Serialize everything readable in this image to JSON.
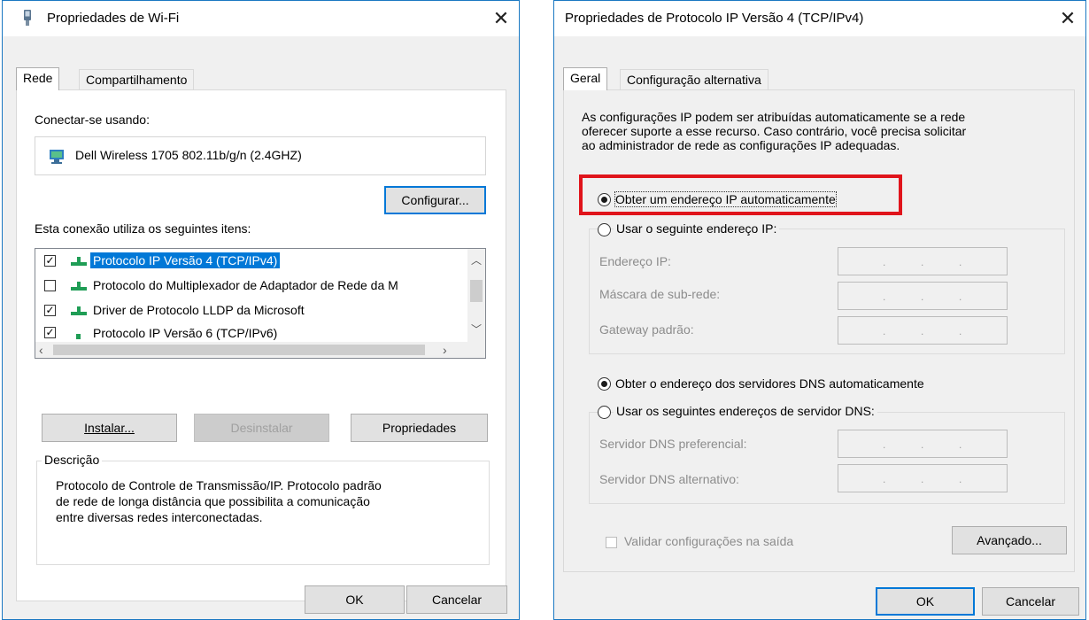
{
  "wifi_dialog": {
    "title": "Propriedades de Wi-Fi",
    "tabs": [
      {
        "label": "Rede",
        "active": true
      },
      {
        "label": "Compartilhamento",
        "active": false
      }
    ],
    "connect_using_label": "Conectar-se usando:",
    "adapter_name": "Dell Wireless 1705 802.11b/g/n (2.4GHZ)",
    "configure_button": "Configurar...",
    "items_label": "Esta conexão utiliza os seguintes itens:",
    "items": [
      {
        "label": "Protocolo IP Versão 4 (TCP/IPv4)",
        "checked": true,
        "selected": true
      },
      {
        "label": "Protocolo do Multiplexador de Adaptador de Rede da M",
        "checked": false,
        "selected": false
      },
      {
        "label": "Driver de Protocolo LLDP da Microsoft",
        "checked": true,
        "selected": false
      },
      {
        "label": "Protocolo IP Versão 6 (TCP/IPv6)",
        "checked": true,
        "selected": false
      }
    ],
    "buttons": {
      "install": "Instalar...",
      "uninstall": "Desinstalar",
      "properties": "Propriedades"
    },
    "description_title": "Descrição",
    "description_text": [
      "Protocolo de Controle de Transmissão/IP. Protocolo padrão",
      "de rede de longa distância que possibilita a comunicação",
      "entre diversas redes interconectadas."
    ],
    "ok": "OK",
    "cancel": "Cancelar"
  },
  "ipv4_dialog": {
    "title": "Propriedades de Protocolo IP Versão 4 (TCP/IPv4)",
    "tabs": [
      {
        "label": "Geral",
        "active": true
      },
      {
        "label": "Configuração alternativa",
        "active": false
      }
    ],
    "intro": [
      "As configurações IP podem ser atribuídas automaticamente se a rede",
      "oferecer suporte a esse recurso. Caso contrário, você precisa solicitar",
      "ao administrador de rede as configurações IP adequadas."
    ],
    "auto_ip_radio": "Obter um endereço IP automaticamente",
    "manual_ip_radio": "Usar o seguinte endereço IP:",
    "ip_fields": [
      {
        "label": "Endereço IP:"
      },
      {
        "label": "Máscara de sub-rede:"
      },
      {
        "label": "Gateway padrão:"
      }
    ],
    "auto_dns_radio": "Obter o endereço dos servidores DNS automaticamente",
    "manual_dns_radio": "Usar os seguintes endereços de servidor DNS:",
    "dns_fields": [
      {
        "label": "Servidor DNS preferencial:"
      },
      {
        "label": "Servidor DNS alternativo:"
      }
    ],
    "validate_checkbox": "Validar configurações na saída",
    "advanced_button": "Avançado...",
    "ok": "OK",
    "cancel": "Cancelar",
    "ip_dots": "."
  },
  "colors": {
    "highlight_red": "#e0141b",
    "selection_blue": "#0078d7",
    "window_border": "#1a78c2"
  },
  "icons": {
    "wifi_title": "network-adapter-icon",
    "adapter": "network-adapter-icon",
    "protocol": "network-protocol-icon",
    "close": "close-icon"
  }
}
